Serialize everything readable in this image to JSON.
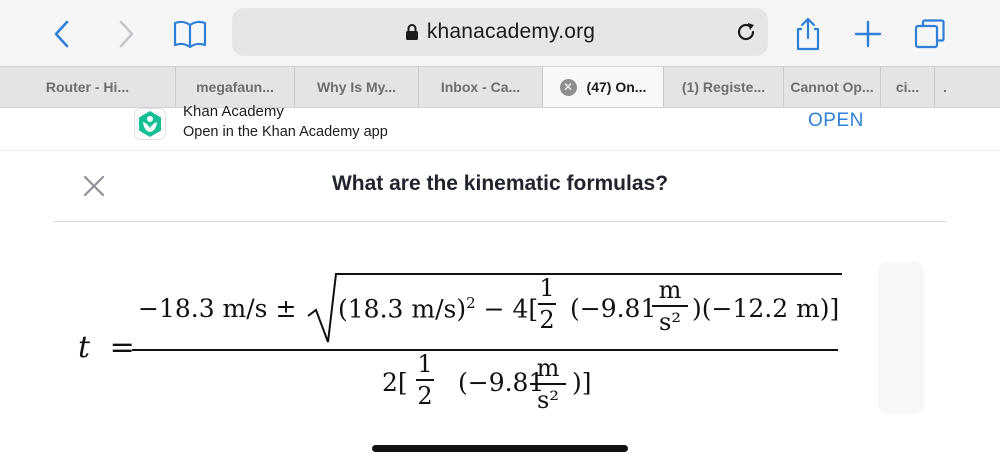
{
  "browser": {
    "url": "khanacademy.org",
    "tabs": [
      {
        "label": "Router - Hi...",
        "active": false
      },
      {
        "label": "megafaun...",
        "active": false
      },
      {
        "label": "Why Is My...",
        "active": false
      },
      {
        "label": "Inbox - Ca...",
        "active": false
      },
      {
        "label": "(47) On...",
        "active": true
      },
      {
        "label": "(1) Registe...",
        "active": false
      },
      {
        "label": "Cannot Op...",
        "active": false
      },
      {
        "label": "ci...",
        "active": false
      },
      {
        "label": ".",
        "active": false
      }
    ]
  },
  "banner": {
    "app_name": "Khan Academy",
    "subtitle": "Open in the Khan Academy app",
    "open_label": "OPEN"
  },
  "page": {
    "title": "What are the kinematic formulas?"
  },
  "equation": {
    "lhs_var": "t",
    "equals": "=",
    "numer_left": "−18.3 m/s ±",
    "rad_a": "(18.3 m/s)",
    "rad_a_exp": "2",
    "rad_minus_four": " − 4[",
    "half_num": "1",
    "half_den": "2",
    "rad_b": "(−9.81",
    "unit_num": "m",
    "unit_den": "s²",
    "rad_c": ")(−12.2 m)]",
    "den_prefix": "2[",
    "den_b": "(−9.81",
    "den_c": ")]"
  },
  "colors": {
    "accent_blue": "#2f7fd9",
    "khan_green": "#14bf96"
  }
}
